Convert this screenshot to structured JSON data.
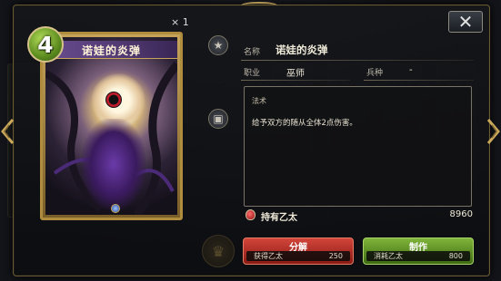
{
  "card": {
    "cost": "4",
    "name": "诺娃的炎弹",
    "copies": "× 1"
  },
  "details": {
    "name_label": "名称",
    "name_value": "诺娃的炎弹",
    "class_label": "职业",
    "class_value": "巫师",
    "tribe_label": "兵种",
    "tribe_value": "-",
    "type_tag": "法术",
    "description": "给予双方的随从全体2点伤害。"
  },
  "ether": {
    "label": "持有乙太",
    "value": "8960"
  },
  "actions": {
    "dismantle_label": "分解",
    "dismantle_sub_label": "获得乙太",
    "dismantle_sub_value": "250",
    "craft_label": "制作",
    "craft_sub_label": "消耗乙太",
    "craft_sub_value": "800"
  },
  "colors": {
    "dismantle": "#c0362c",
    "craft": "#6aa02e",
    "cost_gem": "#7fb43a",
    "frame": "#b08d3e"
  }
}
